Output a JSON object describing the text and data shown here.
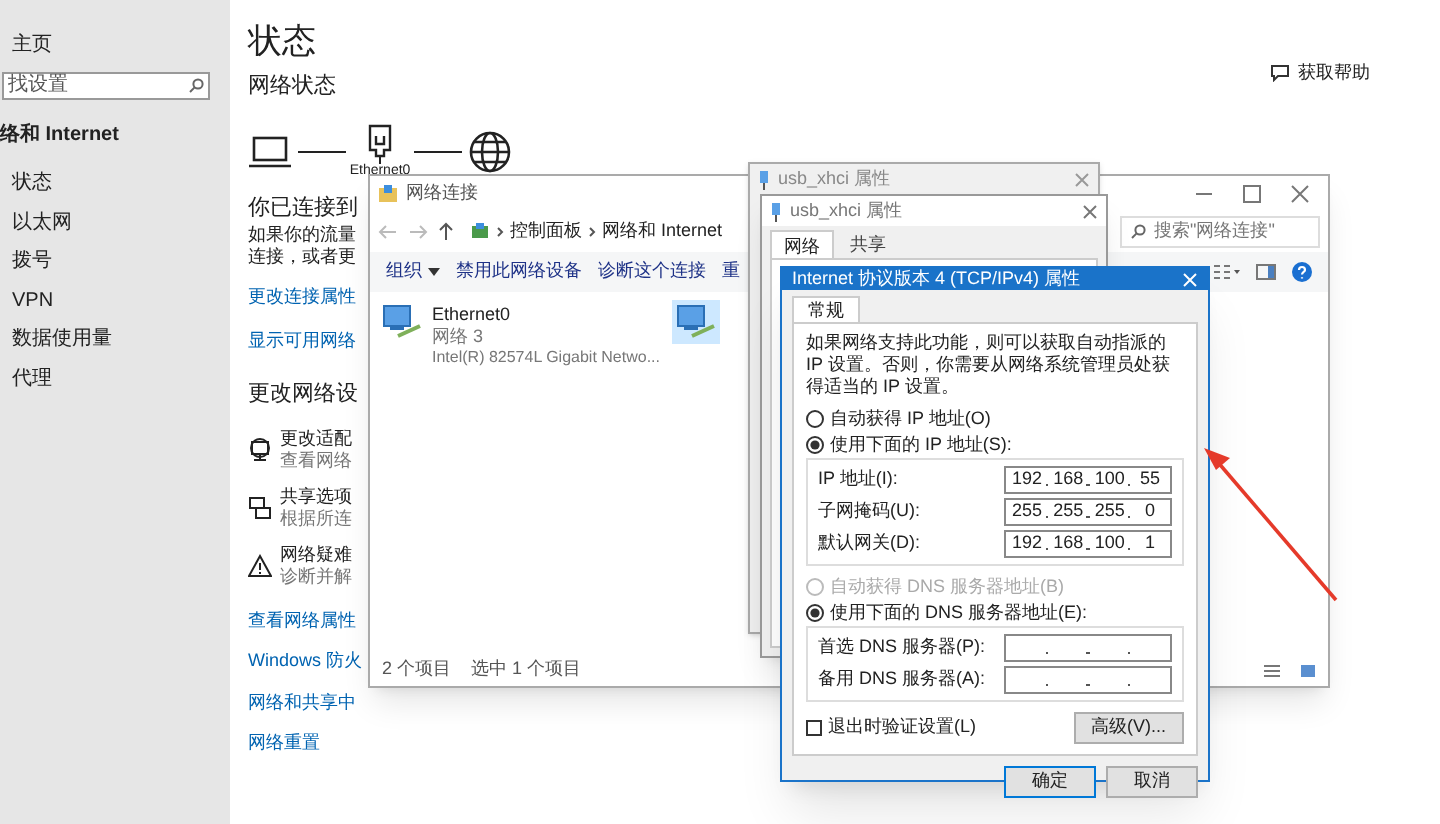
{
  "settings": {
    "sidebar": {
      "home": "主页",
      "search": {
        "placeholder": "找设置"
      },
      "section": "络和 Internet",
      "items": [
        {
          "label": "状态"
        },
        {
          "label": "以太网"
        },
        {
          "label": "拨号"
        },
        {
          "label": "VPN"
        },
        {
          "label": "数据使用量"
        },
        {
          "label": "代理"
        }
      ]
    },
    "main": {
      "title": "状态",
      "subtitle": "网络状态",
      "device_label": "Ethernet0",
      "connected_heading": "你已连接到",
      "description": [
        "如果你的流量",
        "连接，或者更"
      ],
      "links": [
        "更改连接属性",
        "显示可用网络"
      ],
      "section": "更改网络设",
      "options": [
        {
          "kind": "adapter",
          "title": "更改适配",
          "subtitle": "查看网络"
        },
        {
          "kind": "sharing",
          "title": "共享选项",
          "subtitle": "根据所连"
        },
        {
          "kind": "troubleshoot",
          "title": "网络疑难",
          "subtitle": "诊断并解"
        }
      ],
      "more_links": [
        "查看网络属性",
        "Windows 防火",
        "网络和共享中",
        "网络重置"
      ],
      "help": "获取帮助"
    }
  },
  "explorer": {
    "title": "网络连接",
    "breadcrumb": [
      "控制面板",
      "网络和 Internet"
    ],
    "search": {
      "placeholder": "搜索\"网络连接\""
    },
    "commands": [
      {
        "label": "组织",
        "dropdown": true
      },
      {
        "label": "禁用此网络设备",
        "dropdown": false
      },
      {
        "label": "诊断这个连接",
        "dropdown": false
      },
      {
        "label": "重",
        "dropdown": false
      }
    ],
    "items": [
      {
        "name": "Ethernet0",
        "network": "网络 3",
        "device": "Intel(R) 82574L Gigabit Netwo...",
        "selected": false
      },
      {
        "selected": true
      }
    ],
    "status": [
      "2 个项目",
      "选中 1 个项目"
    ]
  },
  "properties_back": {
    "title": "usb_xhci 属性"
  },
  "properties": {
    "title": "usb_xhci 属性",
    "tabs": [
      {
        "label": "网络",
        "selected": true
      },
      {
        "label": "共享",
        "selected": false
      }
    ]
  },
  "ipv4_dialog": {
    "title": "Internet 协议版本 4 (TCP/IPv4) 属性",
    "tabs": [
      {
        "label": "常规",
        "selected": true
      }
    ],
    "description": "如果网络支持此功能，则可以获取自动指派的 IP 设置。否则，你需要从网络系统管理员处获得适当的 IP 设置。",
    "ip_options": [
      {
        "label": "自动获得 IP 地址(O)",
        "selected": false,
        "disabled": false
      },
      {
        "label": "使用下面的 IP 地址(S):",
        "selected": true,
        "disabled": false
      }
    ],
    "ip_fields": [
      {
        "label": "IP 地址(I):",
        "octets": [
          "192",
          "168",
          "100",
          "55"
        ]
      },
      {
        "label": "子网掩码(U):",
        "octets": [
          "255",
          "255",
          "255",
          "0"
        ]
      },
      {
        "label": "默认网关(D):",
        "octets": [
          "192",
          "168",
          "100",
          "1"
        ]
      }
    ],
    "dns_options": [
      {
        "label": "自动获得 DNS 服务器地址(B)",
        "selected": false,
        "disabled": true
      },
      {
        "label": "使用下面的 DNS 服务器地址(E):",
        "selected": true,
        "disabled": false
      }
    ],
    "dns_fields": [
      {
        "label": "首选 DNS 服务器(P):"
      },
      {
        "label": "备用 DNS 服务器(A):"
      }
    ],
    "validate": {
      "label": "退出时验证设置(L)",
      "checked": false
    },
    "advanced": "高级(V)...",
    "ok": "确定",
    "cancel": "取消"
  }
}
